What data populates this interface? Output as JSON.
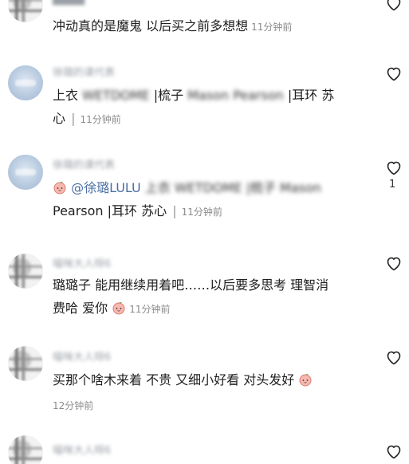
{
  "comments": [
    {
      "username": "████",
      "text": "冲动真的是魔鬼 以后买之前多想想",
      "time": "11分钟前",
      "like_count": ""
    },
    {
      "username": "徐璐的课代表",
      "line1_prefix": "上衣",
      "line1_blur": "WETDOME",
      "line1_mid": "|梳子",
      "line1_blur2": "Mason Pearson",
      "line1_suffix": "|耳环 苏",
      "line2_text": "心",
      "line2_divider": "|",
      "time": "11分钟前",
      "like_count": ""
    },
    {
      "username": "徐璐的课代表",
      "mention": "@徐璐LULU",
      "line1_blur": "上衣 WETDOME |梳子 Mason",
      "line2_text": "Pearson |耳环 苏心",
      "line2_divider": "|",
      "time": "11分钟前",
      "like_count": "1"
    },
    {
      "username": "喵咪大人呀6",
      "line1": "璐璐子 能用继续用着吧……以后要多思考 理智消",
      "line2": "费哈 爱你",
      "time": "11分钟前",
      "like_count": ""
    },
    {
      "username": "喵咪大人呀6",
      "line1": "买那个啥木来着 不贵 又细小好看 对头发好",
      "time": "12分钟前",
      "like_count": ""
    },
    {
      "username": "喵咪大人呀6",
      "like_count": ""
    }
  ],
  "icons": {
    "heart": "heart-outline-icon",
    "emoji": "peach-emoji-icon"
  },
  "colors": {
    "text": "#1f1f1f",
    "time": "#8b8b8b",
    "mention": "#4a6fa5"
  }
}
